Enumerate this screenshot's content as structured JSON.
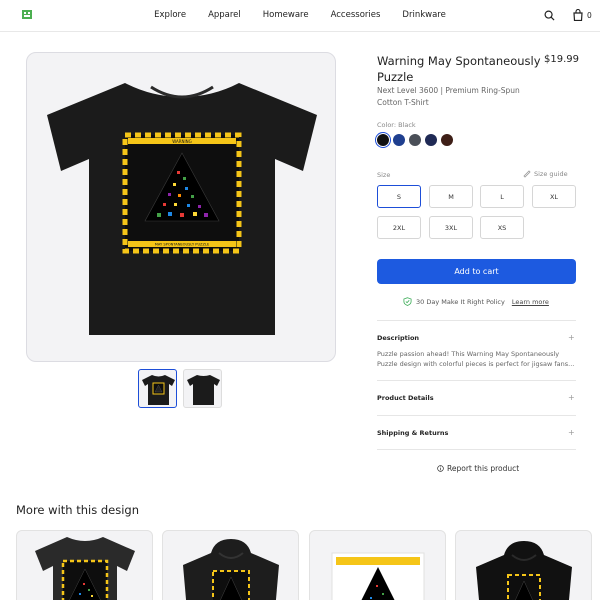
{
  "header": {
    "nav": [
      "Explore",
      "Apparel",
      "Homeware",
      "Accessories",
      "Drinkware"
    ],
    "cart_count": "0"
  },
  "product": {
    "title": "Warning May Spontaneously Puzzle",
    "price": "$19.99",
    "subtitle": "Next Level 3600 | Premium Ring-Spun Cotton T-Shirt",
    "color_label": "Color: Black",
    "colors": [
      "#111111",
      "#1f3f8f",
      "#4a4f58",
      "#1f2a55",
      "#3e1f17"
    ],
    "size_label": "Size",
    "size_guide": "Size guide",
    "sizes": [
      "S",
      "M",
      "L",
      "XL",
      "2XL",
      "3XL",
      "XS"
    ],
    "selected_size": "S",
    "add_to_cart": "Add to cart",
    "policy": "30 Day Make It Right Policy",
    "learn_more": "Learn more",
    "shirt_caption": "MAY SPONTANEOUSLY PUZZLE",
    "warning_text": "WARNING"
  },
  "accordion": {
    "description_title": "Description",
    "description_text": "Puzzle passion ahead! This Warning May Spontaneously Puzzle design with colorful pieces is perfect for jigsaw fans...",
    "details_title": "Product Details",
    "shipping_title": "Shipping & Returns"
  },
  "report": "Report this product",
  "more": {
    "title": "More with this design"
  },
  "colors": {
    "accent": "#1d5ae0",
    "yellow": "#f5c518"
  }
}
